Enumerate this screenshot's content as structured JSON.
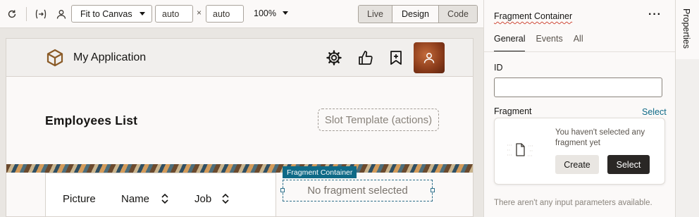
{
  "toolbar": {
    "fit_select": "Fit to Canvas",
    "width_value": "auto",
    "height_value": "auto",
    "times": "×",
    "zoom": "100%",
    "modes": [
      "Live",
      "Design",
      "Code"
    ],
    "active_mode": "Design"
  },
  "app": {
    "title": "My Application",
    "page_title": "Employees List",
    "slot_text": "Slot Template (actions)",
    "columns": [
      "Picture",
      "Name",
      "Job"
    ],
    "fragment_tag": "Fragment Container",
    "fragment_placeholder": "No fragment selected"
  },
  "panel": {
    "title": "Fragment Container",
    "more": "···",
    "tabs": [
      "General",
      "Events",
      "All"
    ],
    "active_tab": "General",
    "id_label": "ID",
    "id_value": "",
    "fragment_label": "Fragment",
    "select_link": "Select",
    "empty_text": "You haven't selected any fragment yet",
    "create_button": "Create",
    "select_button": "Select",
    "no_params": "There aren't any input parameters available."
  },
  "side_tab": {
    "label": "Properties"
  },
  "colors": {
    "accent": "#0f6a87",
    "primary_button": "#2a2725"
  }
}
